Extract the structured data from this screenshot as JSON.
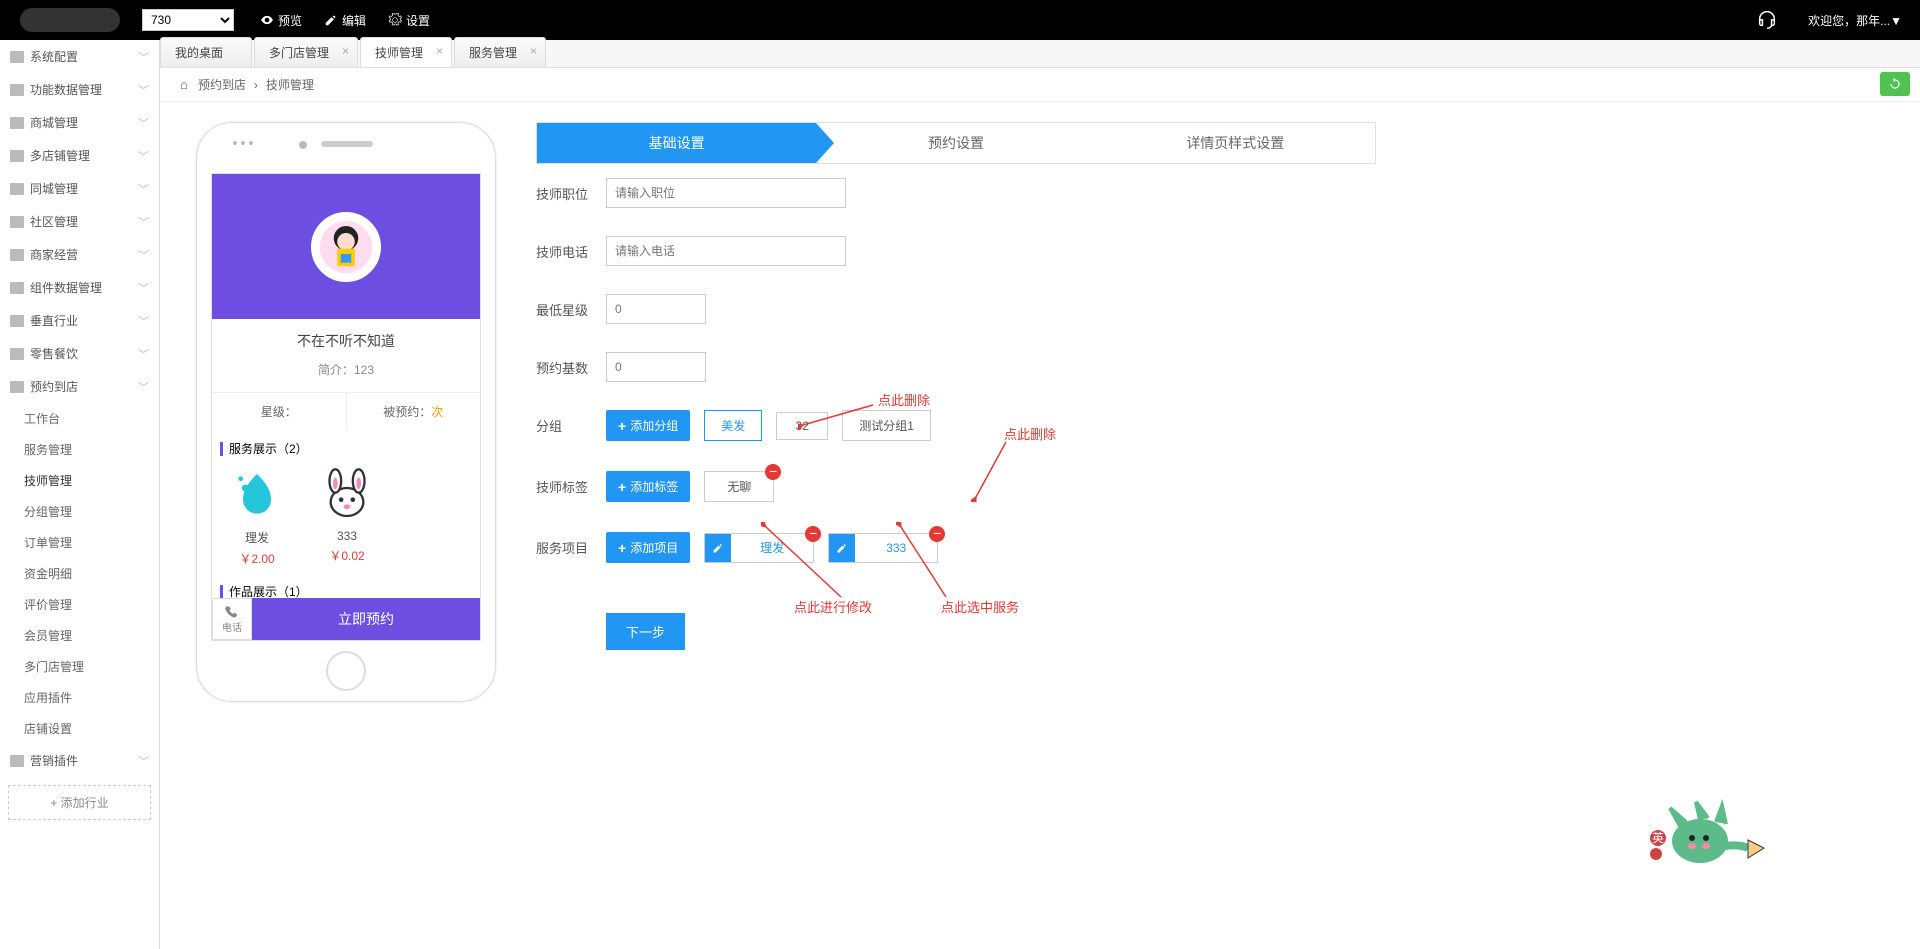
{
  "topbar": {
    "select_value": "730",
    "preview": "预览",
    "edit": "编辑",
    "settings": "设置",
    "welcome": "欢迎您，那年...▼"
  },
  "sidebar": {
    "groups": [
      "系统配置",
      "功能数据管理",
      "商城管理",
      "多店铺管理",
      "同城管理",
      "社区管理",
      "商家经营",
      "组件数据管理",
      "垂直行业",
      "零售餐饮"
    ],
    "active_group": "预约到店",
    "subs": [
      "工作台",
      "服务管理",
      "技师管理",
      "分组管理",
      "订单管理",
      "资金明细",
      "评价管理",
      "会员管理",
      "多门店管理",
      "应用插件",
      "店铺设置"
    ],
    "last_group": "营销插件",
    "add_industry": "+ 添加行业"
  },
  "tabs": {
    "t1": "我的桌面",
    "t2": "多门店管理",
    "t3": "技师管理",
    "t4": "服务管理"
  },
  "breadcrumb": {
    "a": "预约到店",
    "b": "技师管理"
  },
  "phone": {
    "name": "不在不听不知道",
    "intro": "简介：123",
    "star_label": "星级：",
    "book_label": "被预约：",
    "book_unit": "次",
    "section1": "服务展示（2）",
    "svc1_name": "理发",
    "svc1_price": "￥2.00",
    "svc2_name": "333",
    "svc2_price": "￥0.02",
    "section2": "作品展示（1）",
    "call": "电话",
    "book_now": "立即预约"
  },
  "form_tabs": {
    "t1": "基础设置",
    "t2": "预约设置",
    "t3": "详情页样式设置"
  },
  "form": {
    "position_label": "技师职位",
    "position_ph": "请输入职位",
    "phone_label": "技师电话",
    "phone_ph": "请输入电话",
    "star_label": "最低星级",
    "star_ph": "0",
    "base_label": "预约基数",
    "base_ph": "0",
    "group_label": "分组",
    "add_group": "添加分组",
    "group_tag1": "美发",
    "group_tag2": "32",
    "group_tag3": "测试分组1",
    "tag_label": "技师标签",
    "add_tag": "添加标签",
    "tag1": "无聊",
    "service_label": "服务项目",
    "add_service": "添加项目",
    "svc1": "理发",
    "svc2": "333",
    "next": "下一步"
  },
  "annotations": {
    "del1": "点此删除",
    "del2": "点此删除",
    "edit": "点此进行修改",
    "select_svc": "点此选中服务"
  }
}
